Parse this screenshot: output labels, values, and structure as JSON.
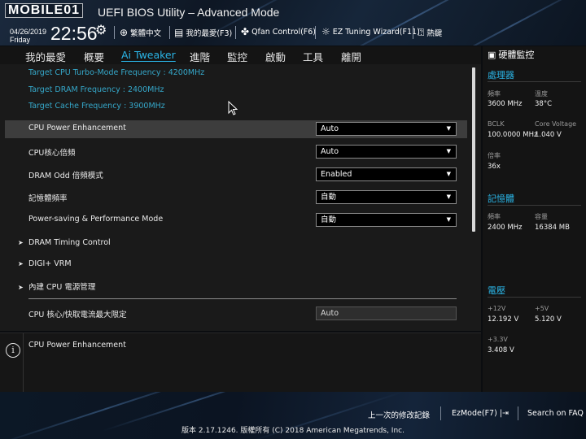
{
  "header": {
    "logo": "MOBILE01",
    "title": "UEFI BIOS Utility – Advanced Mode",
    "date": "04/26/2019",
    "day": "Friday",
    "time": "22:56",
    "items": [
      {
        "icon": "globe-icon",
        "label": "繁體中文"
      },
      {
        "icon": "bookmark-icon",
        "label": "我的最愛(F3)"
      },
      {
        "icon": "fan-icon",
        "label": "Qfan Control(F6)"
      },
      {
        "icon": "bulb-icon",
        "label": "EZ Tuning Wizard(F11)"
      },
      {
        "icon": "help-box-icon",
        "label": "熱鍵"
      }
    ]
  },
  "tabs": [
    "我的最愛",
    "概要",
    "Ai Tweaker",
    "進階",
    "監控",
    "啟動",
    "工具",
    "離開"
  ],
  "active_tab": "Ai Tweaker",
  "main": {
    "info_lines": [
      "Target CPU Turbo-Mode Frequency : 4200MHz",
      "Target DRAM Frequency : 2400MHz",
      "Target Cache Frequency : 3900MHz"
    ],
    "settings": [
      {
        "label": "CPU Power Enhancement",
        "value": "Auto"
      },
      {
        "label": "CPU核心倍頻",
        "value": "Auto"
      },
      {
        "label": "DRAM Odd 倍頻模式",
        "value": "Enabled"
      },
      {
        "label": "記憶體頻率",
        "value": "自動"
      },
      {
        "label": "Power-saving & Performance Mode",
        "value": "自動"
      }
    ],
    "submenus": [
      "DRAM Timing Control",
      "DIGI+ VRM",
      "內建 CPU 電源管理"
    ],
    "limit": {
      "label": "CPU 核心/快取電流最大限定",
      "value": "Auto"
    }
  },
  "help": {
    "text": "CPU Power Enhancement"
  },
  "monitor": {
    "title": "硬體監控",
    "cpu": {
      "header": "處理器",
      "freq_label": "頻率",
      "freq": "3600 MHz",
      "temp_label": "溫度",
      "temp": "38°C",
      "bclk_label": "BCLK",
      "bclk": "100.0000 MHz",
      "core_v_label": "Core Voltage",
      "core_v": "1.040 V",
      "ratio_label": "倍率",
      "ratio": "36x"
    },
    "memory": {
      "header": "記憶體",
      "freq_label": "頻率",
      "freq": "2400 MHz",
      "cap_label": "容量",
      "cap": "16384 MB"
    },
    "voltage": {
      "header": "電壓",
      "v12_label": "+12V",
      "v12": "12.192 V",
      "v5_label": "+5V",
      "v5": "5.120 V",
      "v33_label": "+3.3V",
      "v33": "3.408 V"
    }
  },
  "footer": {
    "last_modified": "上一次的修改記錄",
    "ezmode": "EzMode(F7)",
    "search": "Search on FAQ",
    "copyright": "版本 2.17.1246. 版權所有 (C) 2018 American Megatrends, Inc."
  },
  "colors": {
    "accent": "#2ab4e6",
    "info": "#35a7c9",
    "highlight": "#3d3d3d"
  }
}
